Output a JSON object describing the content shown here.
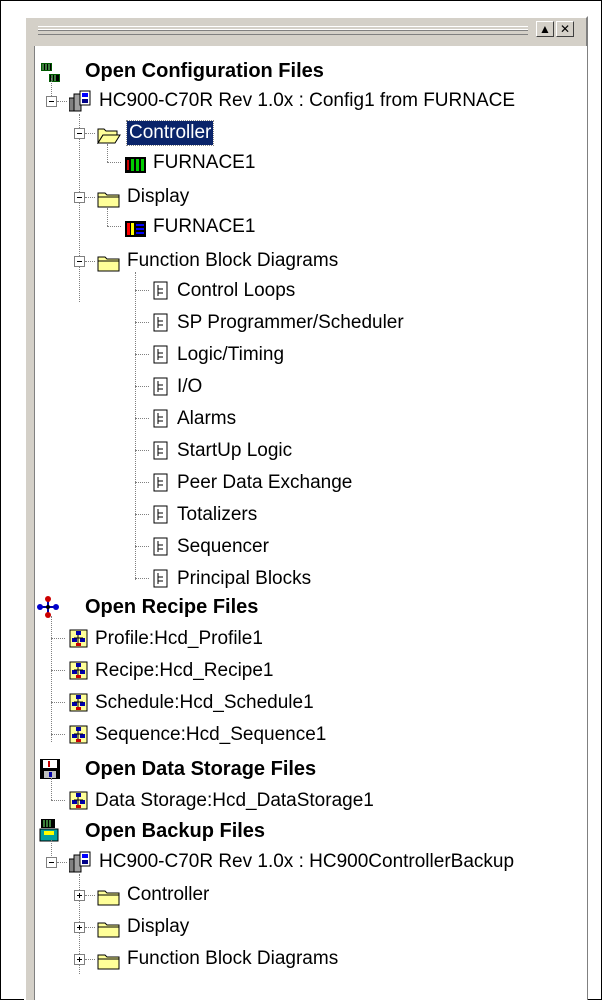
{
  "window": {
    "restore_label": "▲",
    "close_label": "✕"
  },
  "tree": {
    "open_configuration_files": "Open Configuration Files",
    "config_node": "HC900-C70R Rev 1.0x : Config1 from FURNACE",
    "controller": "Controller",
    "controller_child": "FURNACE1",
    "display": "Display",
    "display_child": "FURNACE1",
    "fbd": "Function Block Diagrams",
    "fbd_items": [
      "Control Loops",
      "SP Programmer/Scheduler",
      "Logic/Timing",
      "I/O",
      "Alarms",
      "StartUp Logic",
      "Peer Data Exchange",
      "Totalizers",
      "Sequencer",
      "Principal Blocks"
    ],
    "open_recipe_files": "Open Recipe Files",
    "recipe_items": [
      "Profile:Hcd_Profile1",
      "Recipe:Hcd_Recipe1",
      "Schedule:Hcd_Schedule1",
      "Sequence:Hcd_Sequence1"
    ],
    "open_data_storage_files": "Open Data Storage Files",
    "data_storage_items": [
      "Data Storage:Hcd_DataStorage1"
    ],
    "open_backup_files": "Open Backup Files",
    "backup_node": "HC900-C70R Rev 1.0x : HC900ControllerBackup",
    "backup_children": [
      "Controller",
      "Display",
      "Function Block Diagrams"
    ]
  },
  "colors": {
    "selection": "#0a246a",
    "folder_yellow": "#ffff99",
    "panel_gray": "#d4d0c8"
  }
}
